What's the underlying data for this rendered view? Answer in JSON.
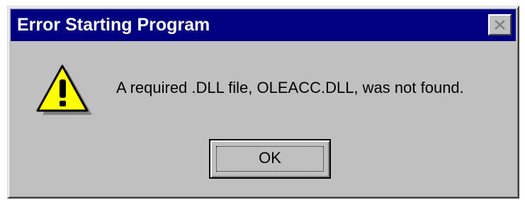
{
  "dialog": {
    "title": "Error Starting Program",
    "message": "A required .DLL file, OLEACC.DLL, was not found.",
    "ok_label": "OK",
    "icon": "warning-icon",
    "close_icon": "close-icon"
  },
  "colors": {
    "titlebar": "#000080",
    "face": "#c0c0c0",
    "warning_fill": "#ffff00"
  }
}
